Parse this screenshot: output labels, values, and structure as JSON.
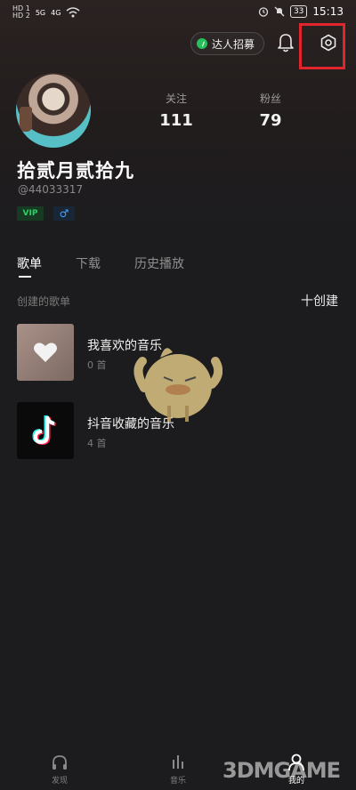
{
  "status_bar": {
    "left_indicators": [
      "HD 1",
      "HD 2",
      "5G",
      "4G"
    ],
    "battery": "33",
    "time": "15:13"
  },
  "header": {
    "talent_button": "达人招募",
    "icons": [
      "bell-icon",
      "settings-icon"
    ],
    "highlight_color": "#e0262c"
  },
  "profile": {
    "following_label": "关注",
    "following_count": "111",
    "fans_label": "粉丝",
    "fans_count": "79",
    "name": "拾贰月贰拾九",
    "id": "@44033317",
    "vip_badge": "VIP",
    "gender_badge": "♂"
  },
  "tabs": [
    {
      "label": "歌单",
      "active": true
    },
    {
      "label": "下载",
      "active": false
    },
    {
      "label": "历史播放",
      "active": false
    }
  ],
  "playlists_section": {
    "title": "创建的歌单",
    "create_button": "十创建",
    "items": [
      {
        "title": "我喜欢的音乐",
        "count": "0 首",
        "cover_icon": "heart-icon"
      },
      {
        "title": "抖音收藏的音乐",
        "count": "4 首",
        "cover_icon": "tiktok-logo-icon"
      }
    ]
  },
  "bottom_nav": [
    {
      "label": "发现",
      "icon": "headphones-icon"
    },
    {
      "label": "音乐",
      "icon": "music-bars-icon"
    },
    {
      "label": "我的",
      "icon": "person-icon"
    }
  ],
  "watermark": {
    "text": "3DMGAME"
  },
  "colors": {
    "background": "#1c1c1e",
    "accent_green": "#25c05a",
    "vip_green": "#2ed06a",
    "gender_blue": "#4aa3ff"
  }
}
